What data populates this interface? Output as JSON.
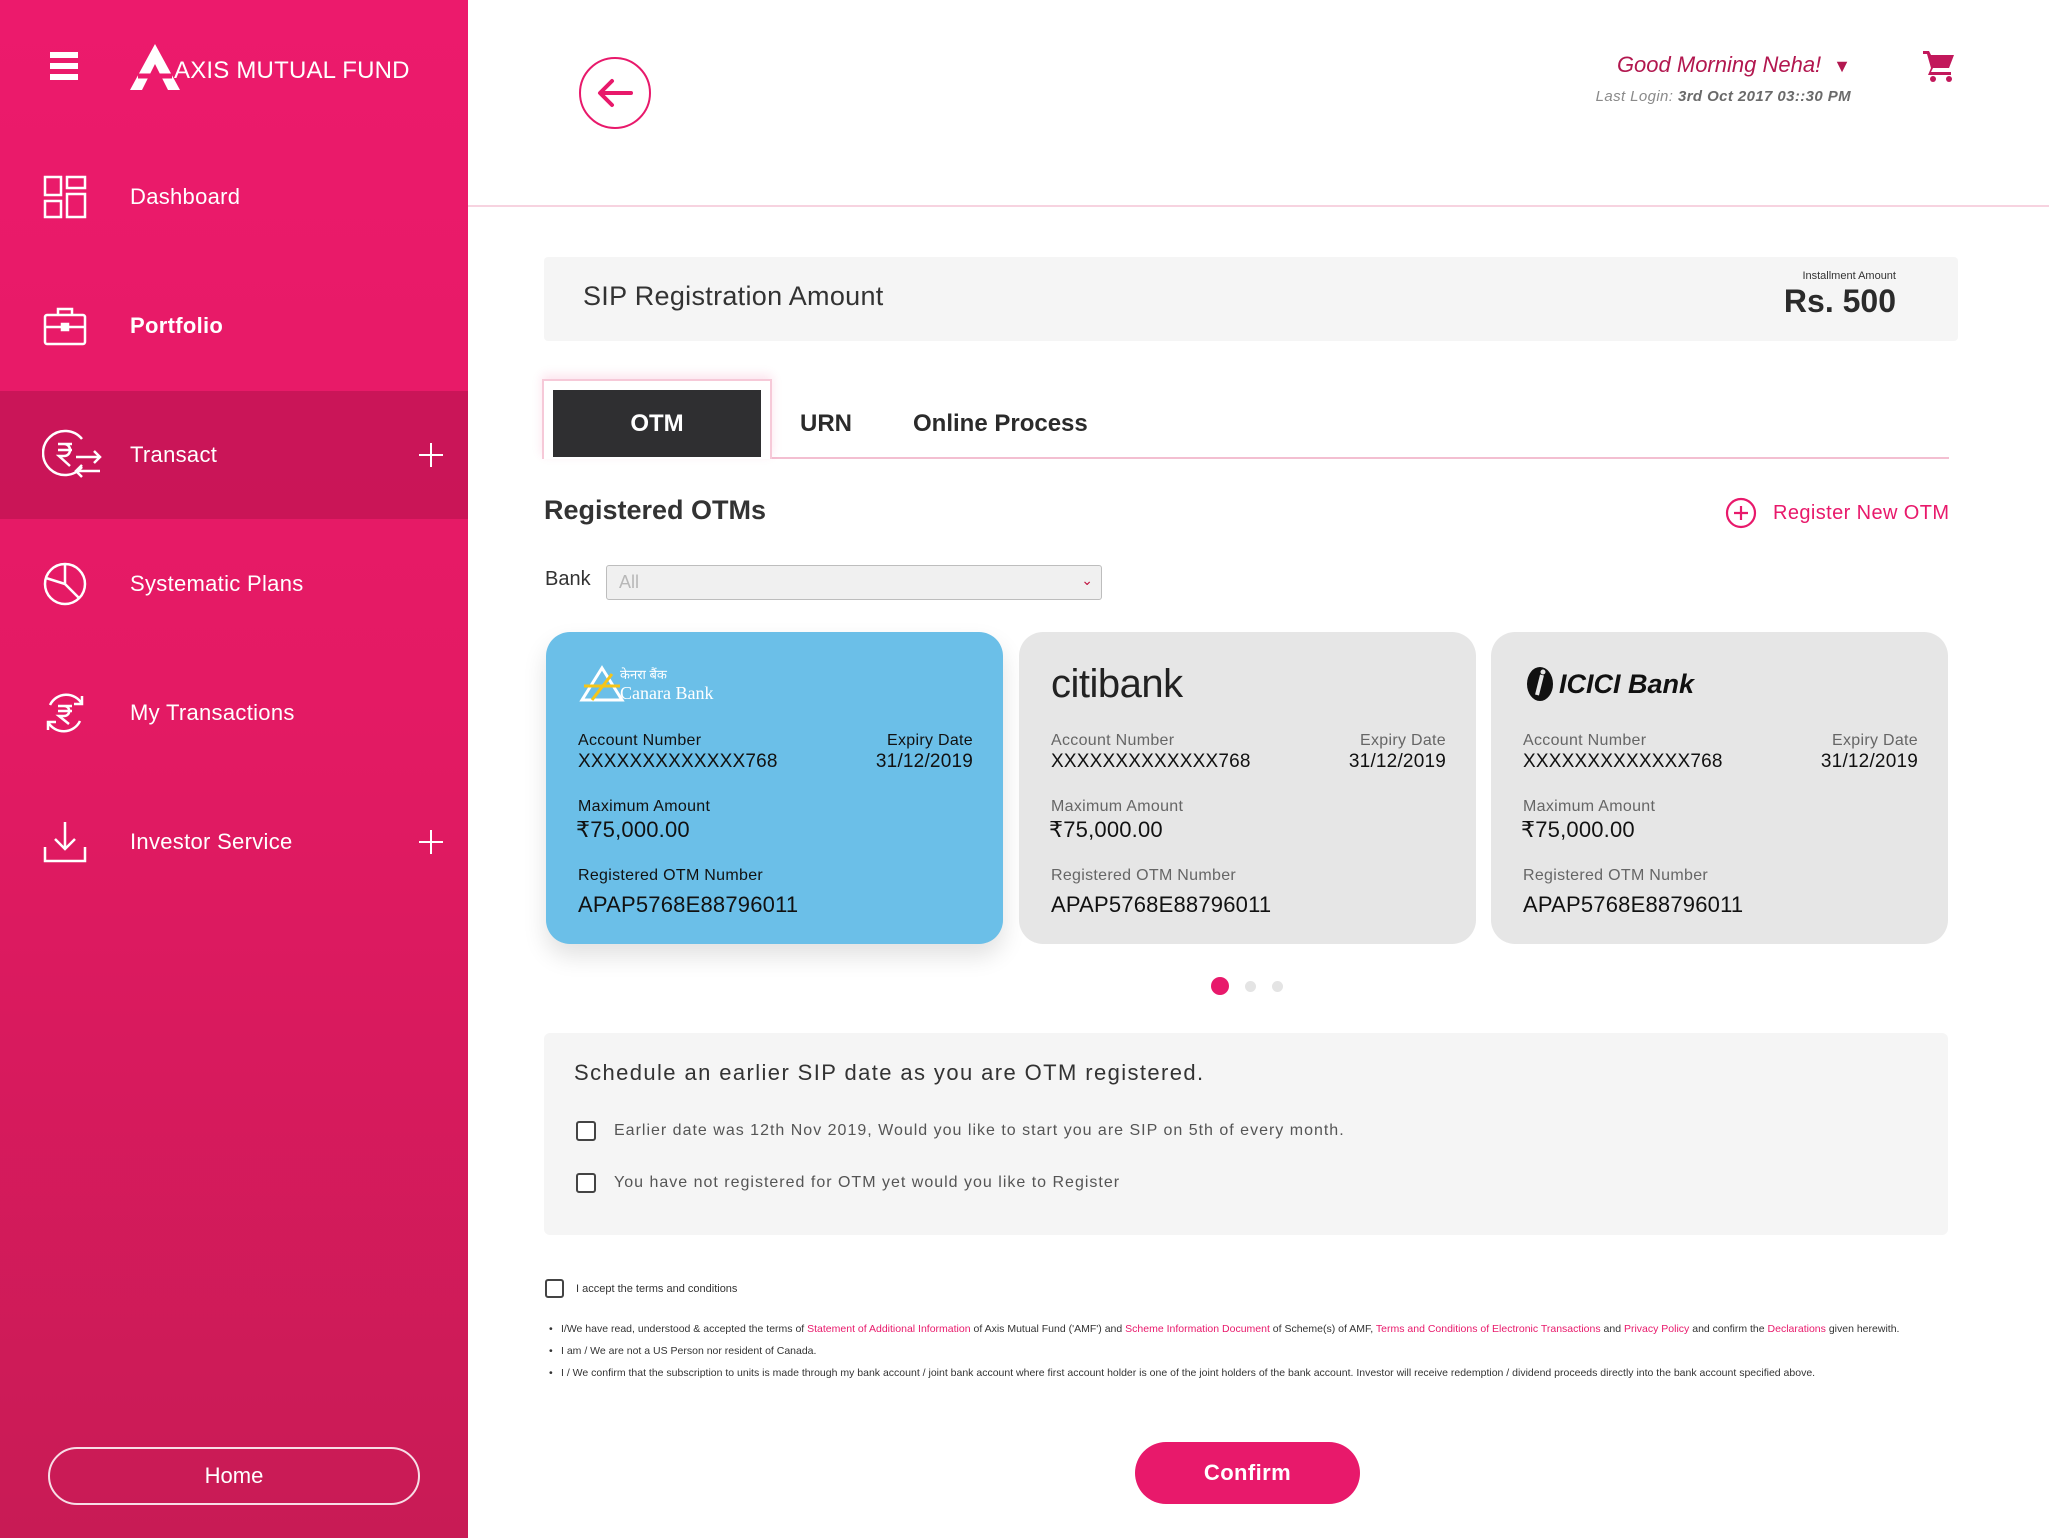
{
  "brand": {
    "name": "AXIS MUTUAL FUND"
  },
  "sidebar": {
    "items": [
      {
        "label": "Dashboard",
        "icon": "dashboard-icon"
      },
      {
        "label": "Portfolio",
        "icon": "briefcase-icon"
      },
      {
        "label": "Transact",
        "icon": "rupee-transfer-icon",
        "expand": "+"
      },
      {
        "label": "Systematic Plans",
        "icon": "pie-chart-icon"
      },
      {
        "label": "My Transactions",
        "icon": "rupee-refresh-icon"
      },
      {
        "label": "Investor Service",
        "icon": "download-icon",
        "expand": "+"
      }
    ],
    "home_label": "Home"
  },
  "header": {
    "greeting": "Good Morning Neha!",
    "last_login_label": "Last Login:",
    "last_login_value": "3rd Oct 2017 03::30 PM"
  },
  "sip": {
    "title": "SIP Registration Amount",
    "installment_label": "Installment Amount",
    "installment_value": "Rs. 500"
  },
  "tabs": [
    {
      "label": "OTM",
      "active": true
    },
    {
      "label": "URN",
      "active": false
    },
    {
      "label": "Online Process",
      "active": false
    }
  ],
  "otm": {
    "title": "Registered OTMs",
    "register_new_label": "Register New OTM",
    "bank_label": "Bank",
    "bank_selected": "All",
    "cards": [
      {
        "bank": "Canara Bank",
        "bank_hindi": "केनरा बैंक",
        "account_label": "Account Number",
        "account_value": "XXXXXXXXXXXXX768",
        "expiry_label": "Expiry Date",
        "expiry_value": "31/12/2019",
        "max_label": "Maximum Amount",
        "max_value": "₹75,000.00",
        "otm_label": "Registered OTM Number",
        "otm_value": "APAP5768E88796011",
        "selected": true
      },
      {
        "bank": "citibank",
        "account_label": "Account Number",
        "account_value": "XXXXXXXXXXXXX768",
        "expiry_label": "Expiry Date",
        "expiry_value": "31/12/2019",
        "max_label": "Maximum Amount",
        "max_value": "₹75,000.00",
        "otm_label": "Registered OTM Number",
        "otm_value": "APAP5768E88796011",
        "selected": false
      },
      {
        "bank": "ICICI Bank",
        "account_label": "Account Number",
        "account_value": "XXXXXXXXXXXXX768",
        "expiry_label": "Expiry Date",
        "expiry_value": "31/12/2019",
        "max_label": "Maximum Amount",
        "max_value": "₹75,000.00",
        "otm_label": "Registered OTM Number",
        "otm_value": "APAP5768E88796011",
        "selected": false
      }
    ],
    "pagination": {
      "pages": 3,
      "current": 1
    }
  },
  "schedule": {
    "title": "Schedule an earlier SIP date as you are OTM registered.",
    "option1": "Earlier date was 12th Nov 2019, Would you like to start you are SIP on 5th of every month.",
    "option2": "You have not registered for OTM yet would you like to Register"
  },
  "terms": {
    "accept_label": "I accept the terms and conditions",
    "b1_p1": "I/We have read, understood & accepted the terms of ",
    "b1_link1": "Statement of Additional Information",
    "b1_p2": " of Axis Mutual Fund ('AMF') and ",
    "b1_link2": "Scheme Information Document",
    "b1_p3": " of Scheme(s) of AMF, ",
    "b1_link3": "Terms and Conditions of Electronic Transactions",
    "b1_p4": " and ",
    "b1_link4": "Privacy Policy",
    "b1_p5": " and confirm the ",
    "b1_link5": "Declarations",
    "b1_p6": " given herewith.",
    "b2": "I am / We are not a US Person nor resident of Canada.",
    "b3": "I / We confirm that the subscription to units is made through my bank account / joint bank account where first account holder is one of the joint holders of the bank account. Investor will receive redemption / dividend proceeds directly into the bank account specified above."
  },
  "confirm_label": "Confirm",
  "colors": {
    "accent": "#e8196b",
    "sidebar": "#e41a64",
    "selected_card": "#6bbfe8",
    "tab_active": "#2f2f31"
  }
}
